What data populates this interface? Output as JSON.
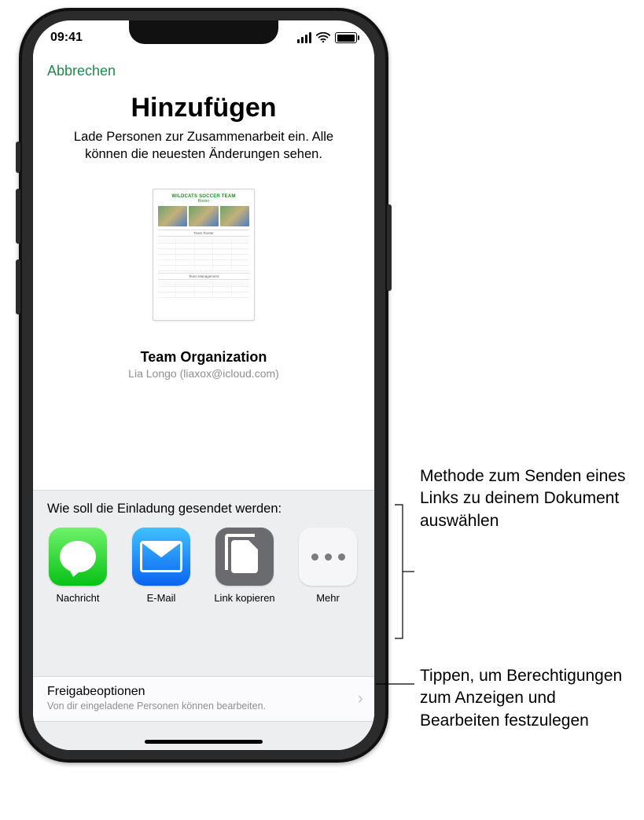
{
  "statusbar": {
    "time": "09:41"
  },
  "nav": {
    "cancel": "Abbrechen"
  },
  "header": {
    "title": "Hinzufügen",
    "subtitle": "Lade Personen zur Zusammenarbeit ein. Alle können die neuesten Änderungen sehen."
  },
  "document": {
    "preview_title": "WILDCATS SOCCER TEAM",
    "preview_subtitle": "Roster",
    "name": "Team Organization",
    "owner": "Lia Longo (liaxox@icloud.com)"
  },
  "share": {
    "section_label": "Wie soll die Einladung gesendet werden:",
    "methods": [
      {
        "label": "Nachricht"
      },
      {
        "label": "E-Mail"
      },
      {
        "label": "Link kopieren"
      },
      {
        "label": "Mehr"
      }
    ]
  },
  "options": {
    "title": "Freigabeoptionen",
    "detail": "Von dir eingeladene Personen können bearbeiten."
  },
  "callouts": {
    "top": "Methode zum Senden eines Links zu deinem Dokument auswählen",
    "bottom": "Tippen, um Berechtigungen zum Anzeigen und Bearbeiten festzulegen"
  }
}
